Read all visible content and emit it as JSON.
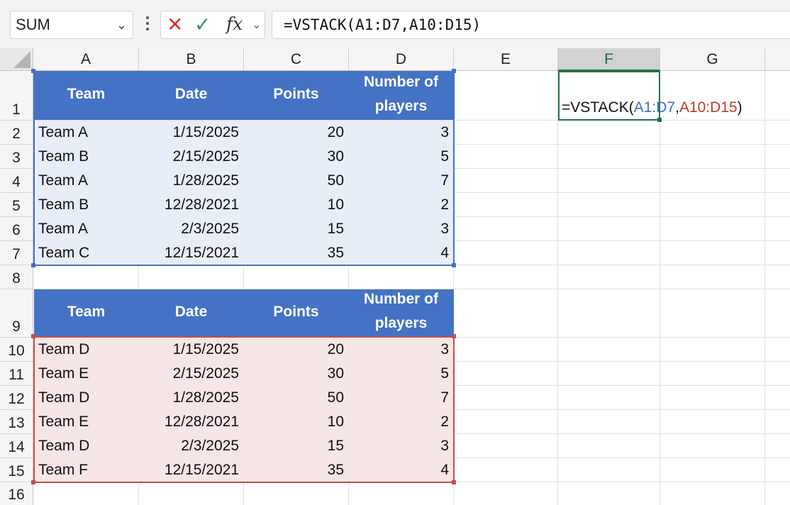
{
  "formula_bar": {
    "name_box": "SUM",
    "name_box_chevron": "chevron-down-icon",
    "cancel_icon": "✕",
    "enter_icon": "✓",
    "fx_label": "fx",
    "formula": "=VSTACK(A1:D7,A10:D15)"
  },
  "columns": [
    "A",
    "B",
    "C",
    "D",
    "E",
    "F",
    "G"
  ],
  "rows": [
    "1",
    "2",
    "3",
    "4",
    "5",
    "6",
    "7",
    "8",
    "9",
    "10",
    "11",
    "12",
    "13",
    "14",
    "15",
    "16"
  ],
  "table1": {
    "headers": [
      "Team",
      "Date",
      "Points",
      "Number of",
      "players"
    ],
    "rows": [
      [
        "Team A",
        "1/15/2025",
        "20",
        "3"
      ],
      [
        "Team B",
        "2/15/2025",
        "30",
        "5"
      ],
      [
        "Team A",
        "1/28/2025",
        "50",
        "7"
      ],
      [
        "Team B",
        "12/28/2021",
        "10",
        "2"
      ],
      [
        "Team A",
        "2/3/2025",
        "15",
        "3"
      ],
      [
        "Team C",
        "12/15/2021",
        "35",
        "4"
      ]
    ]
  },
  "table2": {
    "headers": [
      "Team",
      "Date",
      "Points",
      "Number of",
      "players"
    ],
    "rows": [
      [
        "Team D",
        "1/15/2025",
        "20",
        "3"
      ],
      [
        "Team E",
        "2/15/2025",
        "30",
        "5"
      ],
      [
        "Team D",
        "1/28/2025",
        "50",
        "7"
      ],
      [
        "Team E",
        "12/28/2021",
        "10",
        "2"
      ],
      [
        "Team D",
        "2/3/2025",
        "15",
        "3"
      ],
      [
        "Team F",
        "12/15/2021",
        "35",
        "4"
      ]
    ]
  },
  "active_cell": {
    "prefix": "=VSTACK(",
    "ref1": "A1:D7",
    "sep": ",",
    "ref2": "A10:D15",
    "suffix": ")"
  },
  "colors": {
    "header_fill": "#4472c4",
    "table1_fill": "#e8eef8",
    "table2_fill": "#f7e6e6",
    "ref1_color": "#3a6fc0",
    "ref2_color": "#c0392b",
    "selection_green": "#217346"
  }
}
